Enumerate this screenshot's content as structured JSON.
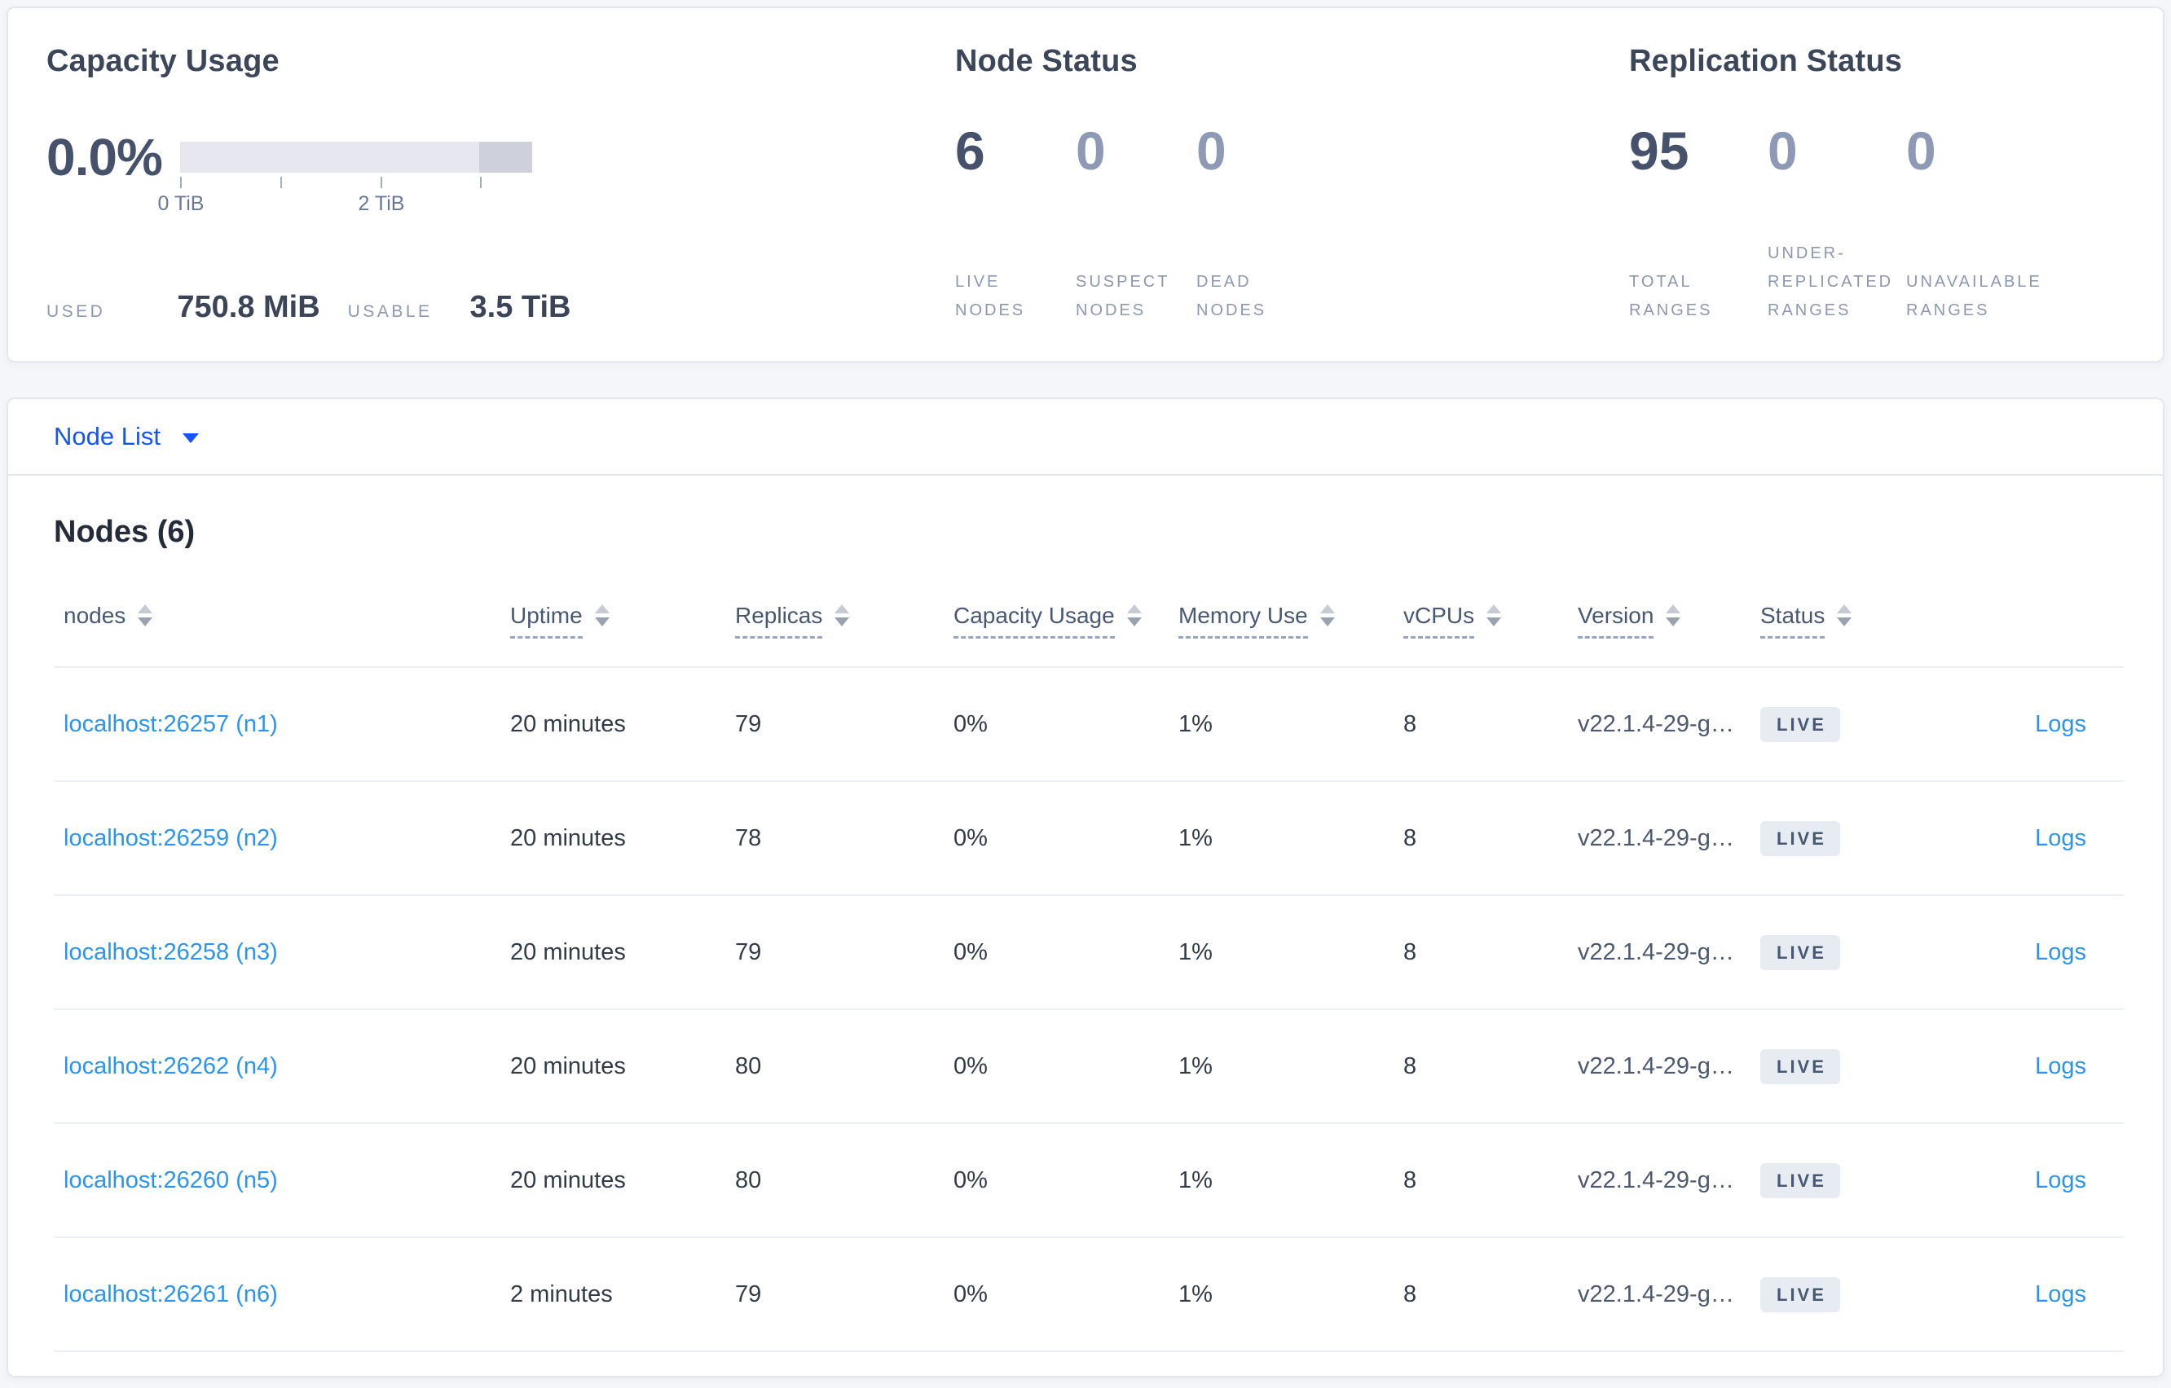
{
  "colors": {
    "page_bg": "#f5f6fa",
    "card_bg": "#ffffff",
    "selector_blue": "#1455f4",
    "link_blue": "#2b94f1",
    "dark_number": "#46526b",
    "muted_number": "#8d99b5",
    "badge_bg": "#e7ebf2",
    "badge_text": "#475872",
    "gauge_light": "#e7e8ef",
    "gauge_dark": "#ced1dc"
  },
  "summary": {
    "capacity": {
      "title": "Capacity Usage",
      "percent": "0.0%",
      "tick_labels": [
        "0 TiB",
        "2 TiB"
      ],
      "used_label": "USED",
      "used_value": "750.8 MiB",
      "usable_label": "USABLE",
      "usable_value": "3.5 TiB"
    },
    "node_status": {
      "title": "Node Status",
      "stats": [
        {
          "value": "6",
          "label": "LIVE NODES"
        },
        {
          "value": "0",
          "label": "SUSPECT NODES"
        },
        {
          "value": "0",
          "label": "DEAD NODES"
        }
      ]
    },
    "replication": {
      "title": "Replication Status",
      "stats": [
        {
          "value": "95",
          "label": "TOTAL RANGES"
        },
        {
          "value": "0",
          "label": "UNDER-REPLICATED RANGES"
        },
        {
          "value": "0",
          "label": "UNAVAILABLE RANGES"
        }
      ]
    }
  },
  "view_selector": {
    "label": "Node List"
  },
  "table": {
    "title": "Nodes (6)",
    "columns": [
      {
        "label": "nodes"
      },
      {
        "label": "Uptime"
      },
      {
        "label": "Replicas"
      },
      {
        "label": "Capacity Usage"
      },
      {
        "label": "Memory Use"
      },
      {
        "label": "vCPUs"
      },
      {
        "label": "Version"
      },
      {
        "label": "Status"
      }
    ],
    "rows": [
      {
        "node": "localhost:26257 (n1)",
        "uptime": "20 minutes",
        "replicas": "79",
        "capacity": "0%",
        "memory": "1%",
        "vcpus": "8",
        "version": "v22.1.4-29-g…",
        "status": "LIVE",
        "logs": "Logs"
      },
      {
        "node": "localhost:26259 (n2)",
        "uptime": "20 minutes",
        "replicas": "78",
        "capacity": "0%",
        "memory": "1%",
        "vcpus": "8",
        "version": "v22.1.4-29-g…",
        "status": "LIVE",
        "logs": "Logs"
      },
      {
        "node": "localhost:26258 (n3)",
        "uptime": "20 minutes",
        "replicas": "79",
        "capacity": "0%",
        "memory": "1%",
        "vcpus": "8",
        "version": "v22.1.4-29-g…",
        "status": "LIVE",
        "logs": "Logs"
      },
      {
        "node": "localhost:26262 (n4)",
        "uptime": "20 minutes",
        "replicas": "80",
        "capacity": "0%",
        "memory": "1%",
        "vcpus": "8",
        "version": "v22.1.4-29-g…",
        "status": "LIVE",
        "logs": "Logs"
      },
      {
        "node": "localhost:26260 (n5)",
        "uptime": "20 minutes",
        "replicas": "80",
        "capacity": "0%",
        "memory": "1%",
        "vcpus": "8",
        "version": "v22.1.4-29-g…",
        "status": "LIVE",
        "logs": "Logs"
      },
      {
        "node": "localhost:26261 (n6)",
        "uptime": "2 minutes",
        "replicas": "79",
        "capacity": "0%",
        "memory": "1%",
        "vcpus": "8",
        "version": "v22.1.4-29-g…",
        "status": "LIVE",
        "logs": "Logs"
      }
    ]
  }
}
